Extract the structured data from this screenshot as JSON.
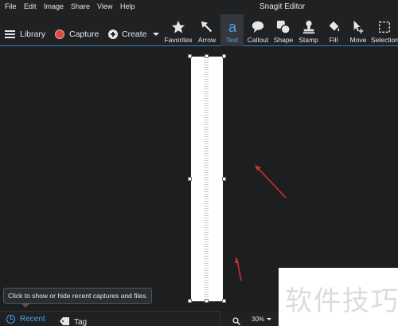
{
  "window": {
    "title": "Snagit Editor"
  },
  "menu": {
    "items": [
      "File",
      "Edit",
      "Image",
      "Share",
      "View",
      "Help"
    ]
  },
  "toolbar": {
    "library_label": "Library",
    "capture_label": "Capture",
    "create_label": "Create",
    "tools": [
      {
        "label": "Favorites",
        "icon": "star-icon"
      },
      {
        "label": "Arrow",
        "icon": "arrow-icon"
      },
      {
        "label": "Text",
        "icon": "text-a-icon",
        "active": true
      },
      {
        "label": "Callout",
        "icon": "speech-bubble-icon"
      },
      {
        "label": "Shape",
        "icon": "shapes-icon"
      },
      {
        "label": "Stamp",
        "icon": "stamp-icon"
      },
      {
        "label": "Fill",
        "icon": "paint-bucket-icon"
      },
      {
        "label": "Move",
        "icon": "move-cursor-icon"
      },
      {
        "label": "Selection",
        "icon": "selection-icon"
      }
    ]
  },
  "tray": {
    "recent_label": "Recent",
    "tag_label": "Tag",
    "tooltip": "Click to show or hide recent captures and files."
  },
  "zoom": {
    "value": "30%"
  },
  "watermark": {
    "text": "软件技巧"
  },
  "colors": {
    "accent": "#4aa3e8",
    "capture_red": "#e04848",
    "annotation_red": "#d03030",
    "background": "#1c1e20"
  }
}
